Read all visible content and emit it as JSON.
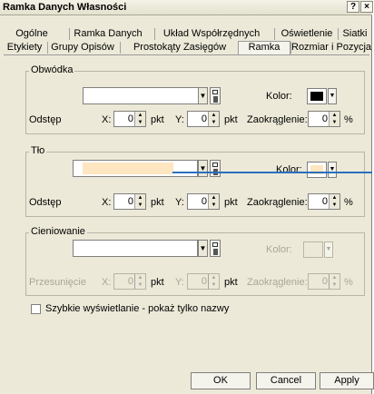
{
  "window": {
    "title": "Ramka Danych Własności",
    "help_btn": "?",
    "close_btn": "×"
  },
  "tabs_row1": [
    "Ogólne",
    "Ramka Danych",
    "Układ Współrzędnych",
    "Oświetlenie",
    "Siatki"
  ],
  "tabs_row2": [
    "Etykiety",
    "Grupy Opisów",
    "Prostokąty Zasięgów",
    "Ramka",
    "Rozmiar i Pozycja"
  ],
  "active_tab": "Ramka",
  "obwodka": {
    "title": "Obwódka",
    "kolor_label": "Kolor:",
    "kolor_value": "#000000",
    "odstep_label": "Odstęp",
    "x_label": "X:",
    "x_value": "0",
    "y_label": "Y:",
    "y_value": "0",
    "unit": "pkt",
    "zaokraglenie_label": "Zaokrąglenie:",
    "zaokraglenie_value": "0",
    "percent": "%"
  },
  "tlo": {
    "title": "Tło",
    "fill_color": "#fde6c0",
    "kolor_label": "Kolor:",
    "kolor_value": "#fde6c0",
    "odstep_label": "Odstęp",
    "x_label": "X:",
    "x_value": "0",
    "y_label": "Y:",
    "y_value": "0",
    "unit": "pkt",
    "zaokraglenie_label": "Zaokrąglenie:",
    "zaokraglenie_value": "0",
    "percent": "%"
  },
  "cieniowanie": {
    "title": "Cieniowanie",
    "kolor_label": "Kolor:",
    "przesuniecie_label": "Przesunięcie",
    "x_label": "X:",
    "x_value": "0",
    "y_label": "Y:",
    "y_value": "0",
    "unit": "pkt",
    "zaokraglenie_label": "Zaokrąglenie:",
    "zaokraglenie_value": "0",
    "percent": "%"
  },
  "szybkie_label": "Szybkie wyświetlanie - pokaż tylko nazwy",
  "buttons": {
    "ok": "OK",
    "cancel": "Cancel",
    "apply": "Apply"
  },
  "colors": {
    "pointer_line": "#2a6fc0"
  }
}
